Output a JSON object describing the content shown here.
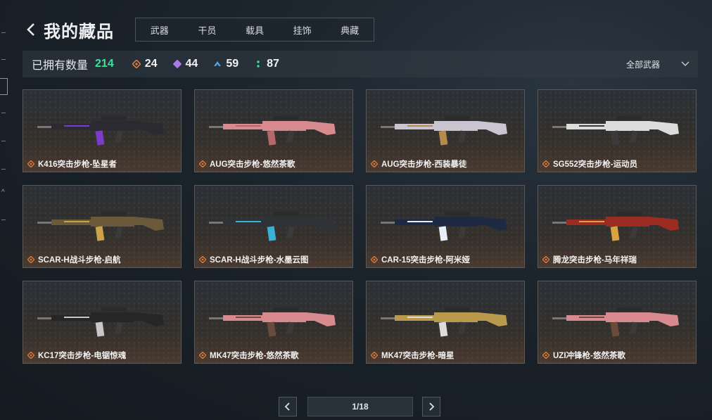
{
  "header": {
    "title": "我的藏品"
  },
  "tabs": [
    {
      "label": "武器",
      "active": true
    },
    {
      "label": "干员",
      "active": false
    },
    {
      "label": "载具",
      "active": false
    },
    {
      "label": "挂饰",
      "active": false
    },
    {
      "label": "典藏",
      "active": false
    }
  ],
  "summary": {
    "owned_label": "已拥有数量",
    "owned_count": "214",
    "owned_color": "#3ee09a",
    "rarities": [
      {
        "icon": "orange-diamond-icon",
        "color": "#e07a3a",
        "count": "24"
      },
      {
        "icon": "purple-diamond-icon",
        "color": "#a77ae8",
        "count": "44"
      },
      {
        "icon": "blue-chevron-icon",
        "color": "#4aa3e6",
        "count": "59"
      },
      {
        "icon": "green-dots-icon",
        "color": "#3ee09a",
        "count": "87"
      }
    ],
    "filter": {
      "label": "全部武器",
      "icon": "chevron-down-icon"
    }
  },
  "cards": [
    {
      "name": "K416突击步枪-坠星者",
      "rarity_icon": "orange-diamond-icon",
      "body": "#2a2a30",
      "accent": "#7b3cc9"
    },
    {
      "name": "AUG突击步枪-悠然茶歌",
      "rarity_icon": "orange-diamond-icon",
      "body": "#d98a8f",
      "accent": "#b7676c"
    },
    {
      "name": "AUG突击步枪-西装暴徒",
      "rarity_icon": "orange-diamond-icon",
      "body": "#c9c4cf",
      "accent": "#b58a4c"
    },
    {
      "name": "SG552突击步枪-运动员",
      "rarity_icon": "orange-diamond-icon",
      "body": "#dcdcdc",
      "accent": "#3a3a3a"
    },
    {
      "name": "SCAR-H战斗步枪-启航",
      "rarity_icon": "orange-diamond-icon",
      "body": "#6b5a3a",
      "accent": "#c9a24a"
    },
    {
      "name": "SCAR-H战斗步枪-水墨云图",
      "rarity_icon": "orange-diamond-icon",
      "body": "#2f3338",
      "accent": "#3ab0d6"
    },
    {
      "name": "CAR-15突击步枪-阿米娅",
      "rarity_icon": "orange-diamond-icon",
      "body": "#1e2a44",
      "accent": "#e8eef6"
    },
    {
      "name": "腾龙突击步枪-马年祥瑞",
      "rarity_icon": "orange-diamond-icon",
      "body": "#9c2b22",
      "accent": "#d9a343"
    },
    {
      "name": "KC17突击步枪-电锯惊魂",
      "rarity_icon": "orange-diamond-icon",
      "body": "#262626",
      "accent": "#c7c7c7"
    },
    {
      "name": "MK47突击步枪-悠然茶歌",
      "rarity_icon": "orange-diamond-icon",
      "body": "#d98a8f",
      "accent": "#6b4a3a"
    },
    {
      "name": "MK47突击步枪-暗星",
      "rarity_icon": "orange-diamond-icon",
      "body": "#b99a4c",
      "accent": "#dcdcdc"
    },
    {
      "name": "UZI冲锋枪-悠然茶歌",
      "rarity_icon": "orange-diamond-icon",
      "body": "#d98a8f",
      "accent": "#6b4a3a"
    }
  ],
  "pagination": {
    "page_label": "1/18",
    "prev_icon": "chevron-left-icon",
    "next_icon": "chevron-right-icon"
  }
}
